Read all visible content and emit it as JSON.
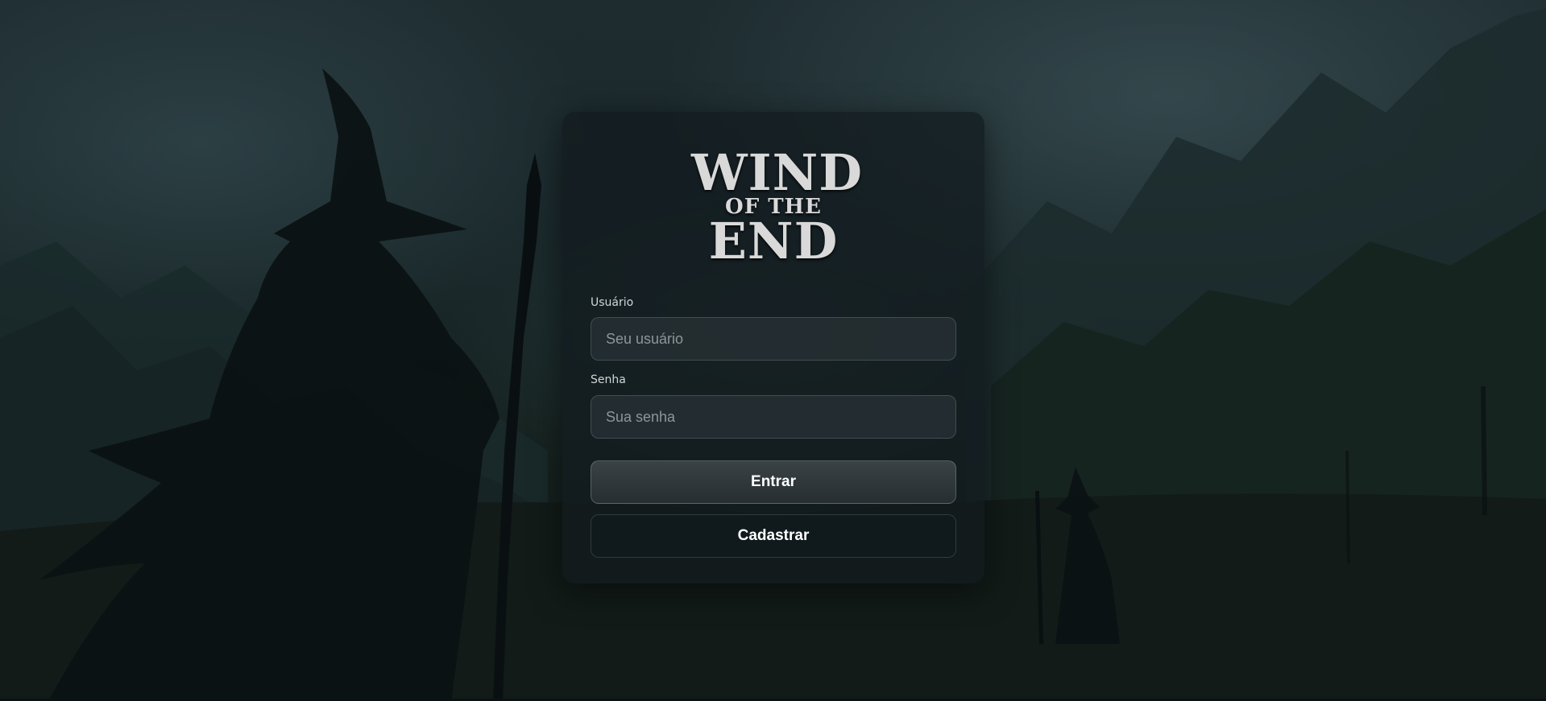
{
  "app": {
    "logo": {
      "line1": "WIND",
      "line2": "OF THE",
      "line3": "END"
    }
  },
  "login": {
    "username_label": "Usuário",
    "username_placeholder": "Seu usuário",
    "username_value": "",
    "password_label": "Senha",
    "password_placeholder": "Sua senha",
    "password_value": "",
    "submit_label": "Entrar",
    "register_label": "Cadastrar"
  },
  "colors": {
    "card_background": "#121b1e",
    "text": "#ffffff",
    "placeholder": "#8e9699"
  }
}
